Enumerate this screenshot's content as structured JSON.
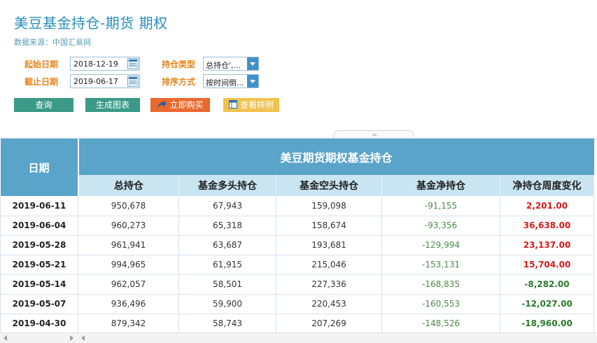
{
  "page": {
    "title": "美豆基金持仓-期货 期权",
    "source": "数据来源：中国汇易网"
  },
  "filters": {
    "start_label": "起始日期",
    "start_value": "2018-12-19",
    "end_label": "截止日期",
    "end_value": "2019-06-17",
    "type_label": "持仓类型",
    "type_value": "总持仓',...",
    "sort_label": "排序方式",
    "sort_value": "按时间倒..."
  },
  "buttons": {
    "query": "查询",
    "chart": "生成图表",
    "buy": "立即购买",
    "example": "查看样例"
  },
  "table": {
    "date_header": "日期",
    "group_header": "美豆期货期权基金持仓",
    "columns": [
      "总持仓",
      "基金多头持仓",
      "基金空头持仓",
      "基金净持仓",
      "净持仓周度变化"
    ],
    "rows": [
      {
        "date": "2019-06-11",
        "total": "950,678",
        "long": "67,943",
        "short": "159,098",
        "net": "-91,155",
        "change": "2,201.00",
        "dir": "up"
      },
      {
        "date": "2019-06-04",
        "total": "960,273",
        "long": "65,318",
        "short": "158,674",
        "net": "-93,356",
        "change": "36,638.00",
        "dir": "up"
      },
      {
        "date": "2019-05-28",
        "total": "961,941",
        "long": "63,687",
        "short": "193,681",
        "net": "-129,994",
        "change": "23,137.00",
        "dir": "up"
      },
      {
        "date": "2019-05-21",
        "total": "994,965",
        "long": "61,915",
        "short": "215,046",
        "net": "-153,131",
        "change": "15,704.00",
        "dir": "up"
      },
      {
        "date": "2019-05-14",
        "total": "962,057",
        "long": "58,501",
        "short": "227,336",
        "net": "-168,835",
        "change": "-8,282.00",
        "dir": "down"
      },
      {
        "date": "2019-05-07",
        "total": "936,496",
        "long": "59,900",
        "short": "220,453",
        "net": "-160,553",
        "change": "-12,027.00",
        "dir": "down"
      },
      {
        "date": "2019-04-30",
        "total": "879,342",
        "long": "58,743",
        "short": "207,269",
        "net": "-148,526",
        "change": "-18,960.00",
        "dir": "down"
      }
    ]
  },
  "colors": {
    "accent": "#2a8fbd",
    "header": "#59a4c8",
    "subheader": "#c9e5f2",
    "positive": "#d01c1c",
    "negative": "#2a7a2a"
  }
}
